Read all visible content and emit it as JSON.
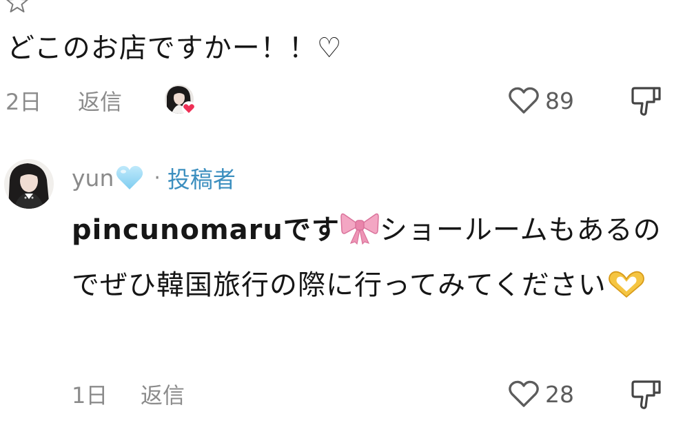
{
  "comment1": {
    "text": "どこのお店ですかー！！♡",
    "time": "2日",
    "reply_label": "返信",
    "like_count": "89"
  },
  "comment2": {
    "username": "yun",
    "username_emoji": "light-blue-heart",
    "separator": "·",
    "author_badge": "投稿者",
    "text_part1": "pincunomaruです",
    "text_emoji1": "ribbon",
    "text_part2": "ショールームもあるのでぜひ韓国旅行の際に行ってみてください",
    "text_emoji2": "heart-hands",
    "time": "1日",
    "reply_label": "返信",
    "like_count": "28"
  },
  "colors": {
    "text": "#161616",
    "muted": "#8b8b8b",
    "author_badge": "#3c8fbf",
    "liked_heart": "#ee2f55"
  },
  "icons": [
    "star-icon",
    "heart-outline-icon",
    "dislike-icon",
    "creator-liked-avatar",
    "avatar"
  ]
}
